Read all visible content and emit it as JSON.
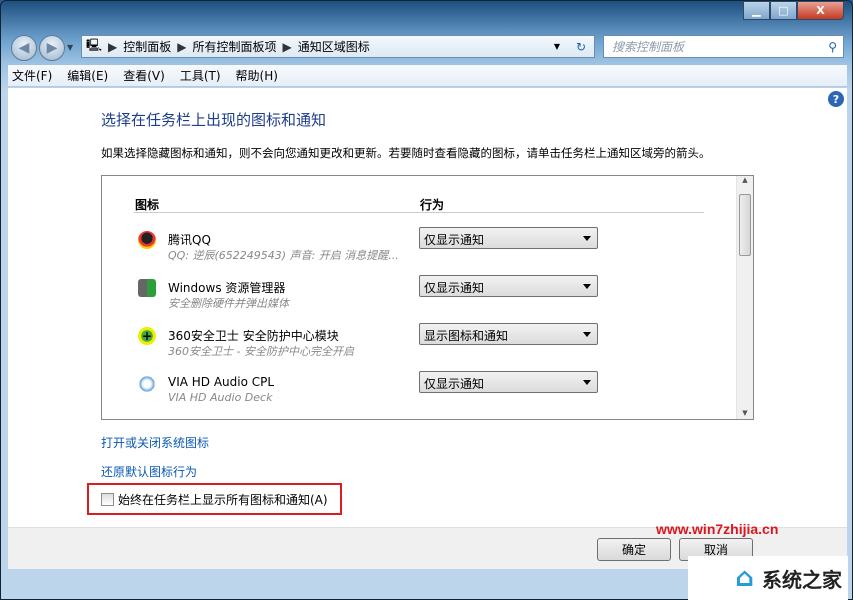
{
  "window": {
    "minimize_icon": "minimize-icon",
    "maximize_icon": "maximize-icon",
    "close_icon": "close-icon"
  },
  "nav": {
    "breadcrumbs": [
      "控制面板",
      "所有控制面板项",
      "通知区域图标"
    ],
    "search_placeholder": "搜索控制面板"
  },
  "menu": [
    "文件(F)",
    "编辑(E)",
    "查看(V)",
    "工具(T)",
    "帮助(H)"
  ],
  "main": {
    "title": "选择在任务栏上出现的图标和通知",
    "description": "如果选择隐藏图标和通知，则不会向您通知更改和更新。若要随时查看隐藏的图标，请单击任务栏上通知区域旁的箭头。",
    "columns": [
      "图标",
      "行为"
    ],
    "rows": [
      {
        "name": "腾讯QQ",
        "sub": "QQ: 逆辰(652249543)  声音: 开启  消息提醒...",
        "behavior": "仅显示通知",
        "icon": "qq-penguin-icon"
      },
      {
        "name": "Windows 资源管理器",
        "sub": "安全删除硬件并弹出媒体",
        "behavior": "仅显示通知",
        "icon": "safely-remove-hardware-icon"
      },
      {
        "name": "360安全卫士 安全防护中心模块",
        "sub": "360安全卫士 - 安全防护中心完全开启",
        "behavior": "显示图标和通知",
        "icon": "360-security-icon"
      },
      {
        "name": "VIA HD Audio CPL",
        "sub": "VIA HD Audio Deck",
        "behavior": "仅显示通知",
        "icon": "via-audio-icon"
      }
    ],
    "link_system_icons": "打开或关闭系统图标",
    "link_restore": "还原默认图标行为",
    "checkbox_label": "始终在任务栏上显示所有图标和通知(A)",
    "checkbox_checked": false
  },
  "buttons": {
    "ok": "确定",
    "cancel": "取消"
  },
  "watermark": {
    "url": "www.win7zhijia.cn",
    "name": "系统之家"
  },
  "colors": {
    "highlight_box": "#d81e1e",
    "link": "#0a58b5",
    "title": "#1e3d8a"
  }
}
